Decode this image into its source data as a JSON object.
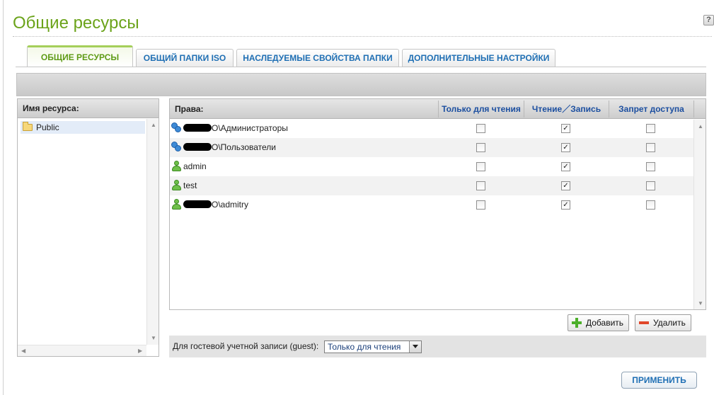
{
  "header": {
    "title": "Общие ресурсы",
    "help_label": "?"
  },
  "tabs": [
    {
      "label": "ОБЩИЕ РЕСУРСЫ",
      "active": true
    },
    {
      "label": "ОБЩИЙ ПАПКИ ISO",
      "active": false
    },
    {
      "label": "НАСЛЕДУЕМЫЕ СВОЙСТВА ПАПКИ",
      "active": false
    },
    {
      "label": "ДОПОЛНИТЕЛЬНЫЕ НАСТРОЙКИ",
      "active": false
    }
  ],
  "resources": {
    "header": "Имя ресурса:",
    "items": [
      {
        "label": "Public",
        "icon": "folder-icon",
        "selected": true
      }
    ]
  },
  "permissions": {
    "header": "Права:",
    "columns": [
      "Только для чтения",
      "Чтение／Запись",
      "Запрет доступа"
    ],
    "rows": [
      {
        "label": "O\\Администраторы",
        "redacted": true,
        "icon": "user-group-icon",
        "read_only": false,
        "read_write": true,
        "deny": false
      },
      {
        "label": "O\\Пользователи",
        "redacted": true,
        "icon": "user-group-icon",
        "read_only": false,
        "read_write": true,
        "deny": false
      },
      {
        "label": "admin",
        "redacted": false,
        "icon": "user-icon",
        "read_only": false,
        "read_write": true,
        "deny": false
      },
      {
        "label": "test",
        "redacted": false,
        "icon": "user-icon",
        "read_only": false,
        "read_write": true,
        "deny": false
      },
      {
        "label": "O\\admitry",
        "redacted": true,
        "icon": "user-icon",
        "read_only": false,
        "read_write": true,
        "deny": false
      }
    ]
  },
  "actions": {
    "add_label": "Добавить",
    "delete_label": "Удалить",
    "apply_label": "ПРИМЕНИТЬ"
  },
  "guest": {
    "label": "Для гостевой учетной записи (guest):",
    "selected": "Только для чтения"
  },
  "colors": {
    "title_green": "#6ba31a",
    "tab_blue": "#1f6fb4",
    "header_blue": "#1c4fa0"
  }
}
